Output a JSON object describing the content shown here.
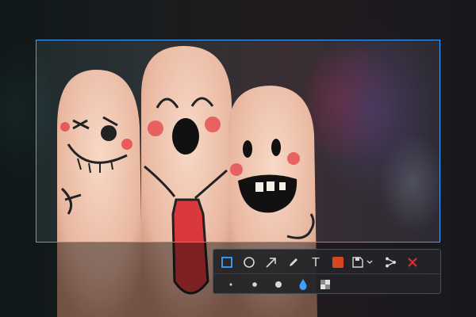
{
  "toolbar": {
    "tools": [
      {
        "name": "rectangle-tool",
        "icon": "rectangle-icon",
        "selected": true
      },
      {
        "name": "ellipse-tool",
        "icon": "circle-icon"
      },
      {
        "name": "arrow-tool",
        "icon": "arrow-icon"
      },
      {
        "name": "pen-tool",
        "icon": "pencil-icon"
      },
      {
        "name": "text-tool",
        "icon": "text-icon",
        "label": "T"
      },
      {
        "name": "color-tool",
        "icon": "color-swatch-icon"
      },
      {
        "name": "save-tool",
        "icon": "save-icon"
      },
      {
        "name": "share-tool",
        "icon": "share-icon"
      },
      {
        "name": "close-tool",
        "icon": "close-icon"
      }
    ],
    "options": [
      {
        "name": "size-small",
        "icon": "small-dot-icon"
      },
      {
        "name": "size-medium",
        "icon": "medium-dot-icon"
      },
      {
        "name": "size-large",
        "icon": "large-dot-icon"
      },
      {
        "name": "fill-tool",
        "icon": "drop-icon"
      },
      {
        "name": "mosaic-tool",
        "icon": "mosaic-icon"
      }
    ]
  },
  "colors": {
    "accent": "#3aa3ff",
    "selected_color": "#d9461e",
    "close": "#e03030",
    "icon": "#d8d8d8"
  }
}
